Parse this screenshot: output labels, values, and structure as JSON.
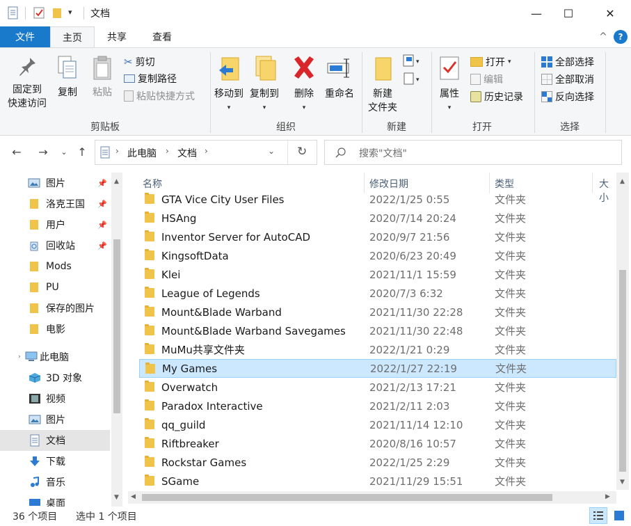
{
  "window": {
    "title": "文档",
    "quick_access_caret": "▾",
    "minimize": "—",
    "maximize": "☐",
    "close": "✕"
  },
  "tabs": {
    "file": "文件",
    "home": "主页",
    "share": "共享",
    "view": "查看",
    "collapse": "^",
    "help": "?"
  },
  "ribbon": {
    "clipboard": {
      "label": "剪贴板",
      "pin": [
        "固定到",
        "快速访问"
      ],
      "copy": "复制",
      "paste": "粘贴",
      "cut": "剪切",
      "copy_path": "复制路径",
      "paste_shortcut": "粘贴快捷方式"
    },
    "organize": {
      "label": "组织",
      "move_to": "移动到",
      "copy_to": "复制到",
      "delete": "删除",
      "rename": "重命名"
    },
    "new": {
      "label": "新建",
      "new_folder": [
        "新建",
        "文件夹"
      ]
    },
    "open": {
      "label": "打开",
      "properties": "属性",
      "open": "打开",
      "edit": "编辑",
      "history": "历史记录"
    },
    "select": {
      "label": "选择",
      "select_all": "全部选择",
      "select_none": "全部取消",
      "invert": "反向选择"
    }
  },
  "address": {
    "segments": [
      "此电脑",
      "文档"
    ],
    "search_placeholder": "搜索\"文档\""
  },
  "nav": {
    "items": [
      {
        "label": "图片",
        "icon": "pictures-icon",
        "pinned": true
      },
      {
        "label": "洛克王国",
        "icon": "folder-icon",
        "pinned": true
      },
      {
        "label": "用户",
        "icon": "folder-icon",
        "pinned": true
      },
      {
        "label": "回收站",
        "icon": "recycle-bin-icon",
        "pinned": true
      },
      {
        "label": "Mods",
        "icon": "folder-icon",
        "pinned": false
      },
      {
        "label": "PU",
        "icon": "folder-icon",
        "pinned": false
      },
      {
        "label": "保存的图片",
        "icon": "folder-icon",
        "pinned": false
      },
      {
        "label": "电影",
        "icon": "folder-icon",
        "pinned": false
      }
    ],
    "this_pc": "此电脑",
    "pc_items": [
      {
        "label": "3D 对象",
        "icon": "3d-objects-icon"
      },
      {
        "label": "视频",
        "icon": "videos-icon"
      },
      {
        "label": "图片",
        "icon": "pictures-icon"
      },
      {
        "label": "文档",
        "icon": "documents-icon",
        "selected": true
      },
      {
        "label": "下载",
        "icon": "downloads-icon"
      },
      {
        "label": "音乐",
        "icon": "music-icon"
      },
      {
        "label": "桌面",
        "icon": "desktop-icon"
      }
    ]
  },
  "list": {
    "columns": {
      "name": "名称",
      "date": "修改日期",
      "type": "类型",
      "size": "大小"
    },
    "sort_indicator": "^",
    "rows": [
      {
        "name": "GTA Vice City User Files",
        "date": "2022/1/25 0:55",
        "type": "文件夹"
      },
      {
        "name": "HSAng",
        "date": "2020/7/14 20:24",
        "type": "文件夹"
      },
      {
        "name": "Inventor Server for AutoCAD",
        "date": "2020/9/7 21:56",
        "type": "文件夹"
      },
      {
        "name": "KingsoftData",
        "date": "2020/6/23 20:49",
        "type": "文件夹"
      },
      {
        "name": "Klei",
        "date": "2021/11/1 15:59",
        "type": "文件夹"
      },
      {
        "name": "League of Legends",
        "date": "2020/7/3 6:32",
        "type": "文件夹"
      },
      {
        "name": "Mount&Blade Warband",
        "date": "2021/11/30 22:28",
        "type": "文件夹"
      },
      {
        "name": "Mount&Blade Warband Savegames",
        "date": "2021/11/30 22:48",
        "type": "文件夹"
      },
      {
        "name": "MuMu共享文件夹",
        "date": "2022/1/21 0:29",
        "type": "文件夹"
      },
      {
        "name": "My Games",
        "date": "2022/1/27 22:19",
        "type": "文件夹",
        "selected": true
      },
      {
        "name": "Overwatch",
        "date": "2021/2/13 17:21",
        "type": "文件夹"
      },
      {
        "name": "Paradox Interactive",
        "date": "2021/2/11 2:03",
        "type": "文件夹"
      },
      {
        "name": "qq_guild",
        "date": "2021/11/14 12:10",
        "type": "文件夹"
      },
      {
        "name": "Riftbreaker",
        "date": "2020/8/16 10:57",
        "type": "文件夹"
      },
      {
        "name": "Rockstar Games",
        "date": "2022/1/25 2:29",
        "type": "文件夹"
      },
      {
        "name": "SGame",
        "date": "2021/11/29 15:51",
        "type": "文件夹"
      }
    ]
  },
  "status": {
    "count": "36 个项目",
    "selection": "选中 1 个项目"
  },
  "colors": {
    "accent": "#1979ca",
    "selection_bg": "#cce8ff",
    "folder": "#f0c34a"
  }
}
